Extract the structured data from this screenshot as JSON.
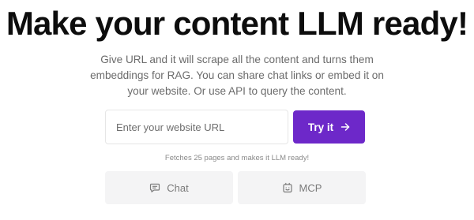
{
  "hero": {
    "title": "Make your content LLM ready!",
    "description": "Give URL and it will scrape all the content and turns them embeddings for RAG. You can share chat links or embed it on your website. Or use API to query the content."
  },
  "url_form": {
    "placeholder": "Enter your website URL",
    "value": "",
    "submit_label": "Try it",
    "submit_icon": "arrow-right-icon",
    "note": "Fetches 25 pages and makes it LLM ready!"
  },
  "tabs": [
    {
      "label": "Chat",
      "icon": "chat-icon"
    },
    {
      "label": "MCP",
      "icon": "mcp-icon"
    }
  ],
  "colors": {
    "accent": "#6d28c9",
    "tab_background": "#f4f4f5",
    "muted_text": "#6b6b6b"
  }
}
